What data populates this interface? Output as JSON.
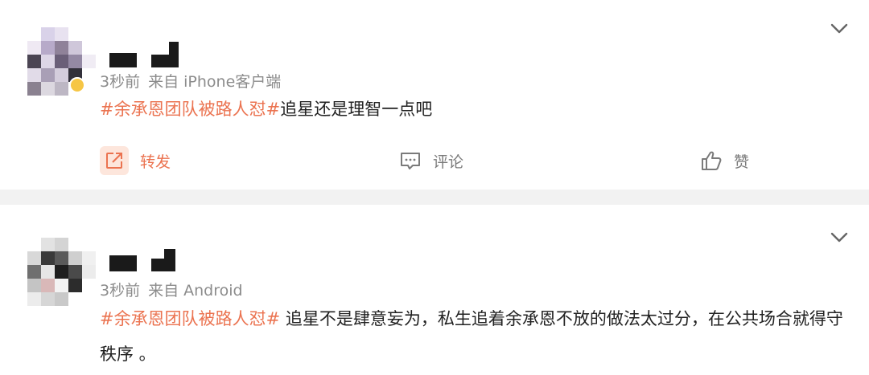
{
  "colors": {
    "accent": "#eb7350",
    "meta": "#8c8c8c",
    "divider": "#f2f2f2"
  },
  "posts": [
    {
      "time": "3秒前",
      "source": "来自 iPhone客户端",
      "hashtag": "#余承恩团队被路人怼#",
      "text": "追星还是理智一点吧",
      "actions": {
        "repost": "转发",
        "comment": "评论",
        "like": "赞"
      },
      "icons": [
        "chevron-down-icon",
        "repost-icon",
        "comment-icon",
        "like-icon"
      ]
    },
    {
      "time": "3秒前",
      "source": "来自 Android",
      "hashtag": "#余承恩团队被路人怼#",
      "text": " 追星不是肆意妄为，私生追着余承恩不放的做法太过分，在公共场合就得守秩序 。",
      "icons": [
        "chevron-down-icon"
      ]
    }
  ]
}
